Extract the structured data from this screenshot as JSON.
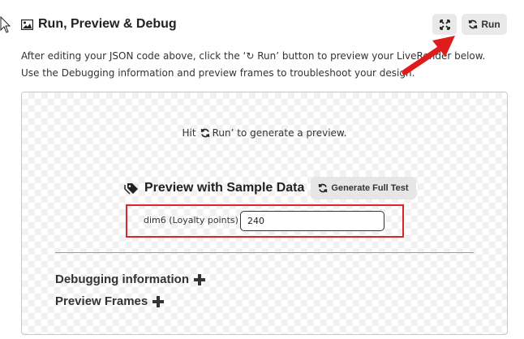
{
  "header": {
    "title": "Run, Preview & Debug",
    "run_label": "Run"
  },
  "description": "After editing your JSON code above, click the ‘↻ Run’ button to preview your LiveRender below. Use the Debugging information and preview frames to troubleshoot your design.",
  "preview": {
    "hint_before": "Hit",
    "hint_after": "Run’ to generate a preview."
  },
  "sample": {
    "title": "Preview with Sample Data",
    "generate_label": "Generate Full Test",
    "param_label": "dim6 (Loyalty points)",
    "param_value": "240"
  },
  "sections": {
    "debugging": "Debugging information",
    "frames": "Preview Frames"
  },
  "colors": {
    "highlight_border": "#d9262a",
    "arrow": "#e01b1b",
    "button_bg": "#e9e9e9"
  }
}
